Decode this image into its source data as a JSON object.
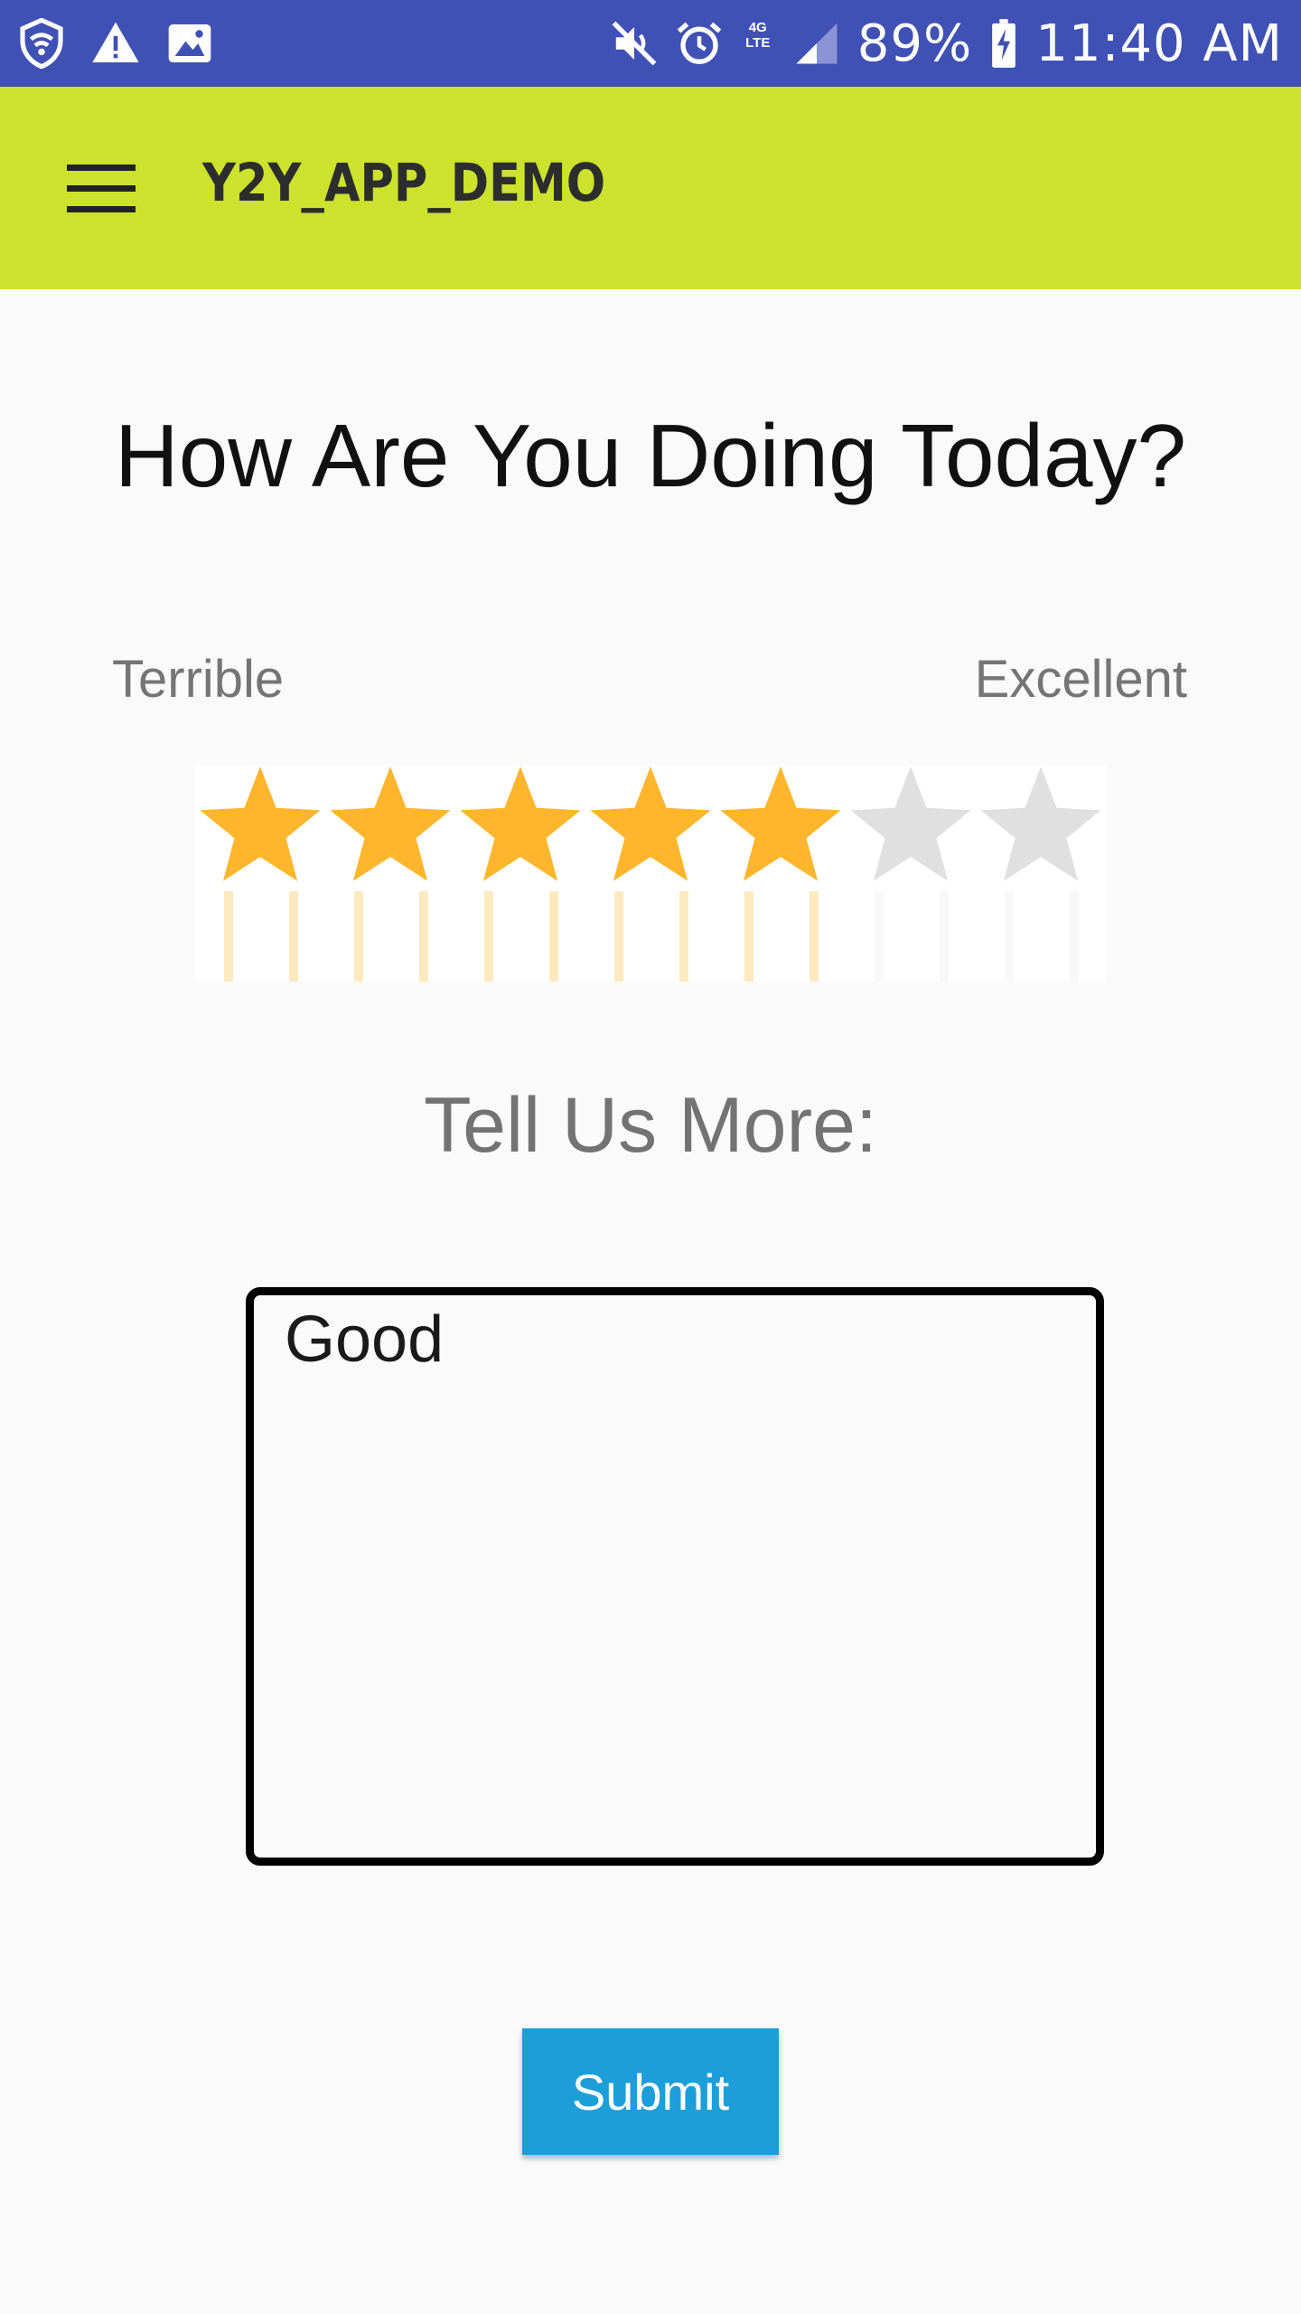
{
  "status_bar": {
    "battery": "89%",
    "time": "11:40 AM",
    "network_label": "4G LTE",
    "icons_left": [
      "shield-wifi-icon",
      "warning-icon",
      "image-icon"
    ],
    "icons_right": [
      "mute-icon",
      "alarm-icon",
      "network-4g-icon",
      "signal-icon",
      "battery-charging-icon"
    ]
  },
  "app_bar": {
    "title": "Y2Y_APP_DEMO",
    "menu_icon": "hamburger-menu-icon",
    "background": "#cde22d"
  },
  "survey": {
    "question": "How Are You Doing Today?",
    "scale_min_label": "Terrible",
    "scale_max_label": "Excellent",
    "rating": {
      "value": 5,
      "max": 7,
      "filled_color": "#ffb62c",
      "empty_color": "#e0e0e0"
    },
    "more_label": "Tell Us More:",
    "comment_value": "Good"
  },
  "submit": {
    "label": "Submit",
    "color": "#1c9ed9"
  },
  "colors": {
    "status_bar": "#3f51b5",
    "app_bar": "#cde22d",
    "background": "#fafafa"
  }
}
